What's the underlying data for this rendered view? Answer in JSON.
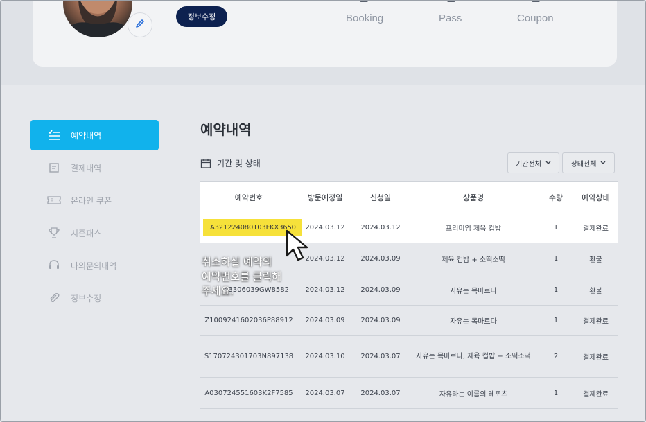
{
  "profile": {
    "edit_button": "정보수정",
    "stats": [
      "Booking",
      "Pass",
      "Coupon"
    ]
  },
  "sidebar": {
    "items": [
      {
        "label": "예약내역",
        "icon": "checklist-icon",
        "active": true
      },
      {
        "label": "결제내역",
        "icon": "receipt-icon"
      },
      {
        "label": "온라인 쿠폰",
        "icon": "ticket-icon"
      },
      {
        "label": "시즌패스",
        "icon": "trophy-icon"
      },
      {
        "label": "나의문의내역",
        "icon": "headset-icon"
      },
      {
        "label": "정보수정",
        "icon": "paperclip-icon"
      }
    ]
  },
  "main": {
    "title": "예약내역",
    "filter_label": "기간 및 상태",
    "period_dropdown": "기간전체",
    "status_dropdown": "상태전체"
  },
  "table": {
    "headers": [
      "예약번호",
      "방문예정일",
      "신청일",
      "상품명",
      "수량",
      "예약상태"
    ],
    "rows": [
      [
        "A321224080103FKX3650",
        "2024.03.12",
        "2024.03.12",
        "프리미엄 제육 컵밥",
        "1",
        "결제완료"
      ],
      [
        "",
        "2024.03.12",
        "2024.03.09",
        "제육 컵밥 + 소떡소떡",
        "1",
        "환불"
      ],
      [
        "43306039GW8582",
        "2024.03.12",
        "2024.03.09",
        "자유는 목마르다",
        "1",
        "환불"
      ],
      [
        "Z1009241602036P88912",
        "2024.03.09",
        "2024.03.09",
        "자유는 목마르다",
        "1",
        "결제완료"
      ],
      [
        "S170724301703N897138",
        "2024.03.10",
        "2024.03.07",
        "자유는 목마르다, 제육 컵밥 + 소떡소떡",
        "2",
        "결제완료"
      ],
      [
        "A030724551603K2F7585",
        "2024.03.07",
        "2024.03.07",
        "자유라는 이름의 레포츠",
        "1",
        "결제완료"
      ]
    ]
  },
  "callout": {
    "line1": "취소하실 예약의",
    "line2": "예약번호를 클릭해",
    "line3": "주세요."
  },
  "colors": {
    "accent": "#11b2ec",
    "navy": "#0d2150",
    "highlight": "#f6e13a"
  }
}
